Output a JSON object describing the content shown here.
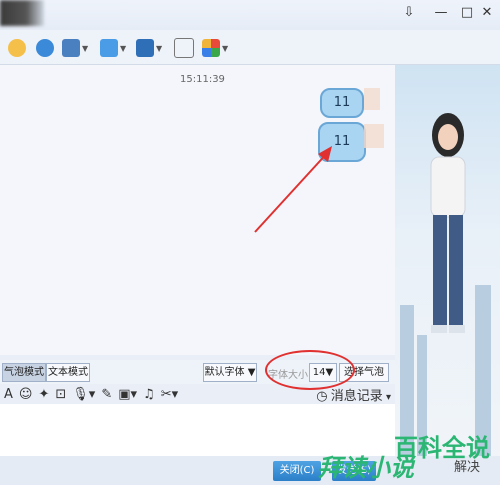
{
  "chat": {
    "timestamp": "15:11:39",
    "messages": [
      {
        "text": "11"
      },
      {
        "text": "11"
      }
    ]
  },
  "format_bar": {
    "bubble_mode_tab": "气泡模式",
    "text_mode_tab": "文本模式",
    "font_select": "默认字体",
    "font_size_label": "字体大小",
    "font_size_value": "14",
    "choose_bubble": "选择气泡"
  },
  "message_history": "消息记录",
  "buttons": {
    "close": "关闭(C)",
    "send": "发送(S)"
  },
  "watermark": {
    "big": "百科全说",
    "small": "解决",
    "fancy": "拜读小说"
  },
  "icons": [
    "snowflake-icon",
    "camera-icon",
    "screen-icon",
    "folder-icon",
    "display-icon",
    "message-icon",
    "apps-icon"
  ]
}
